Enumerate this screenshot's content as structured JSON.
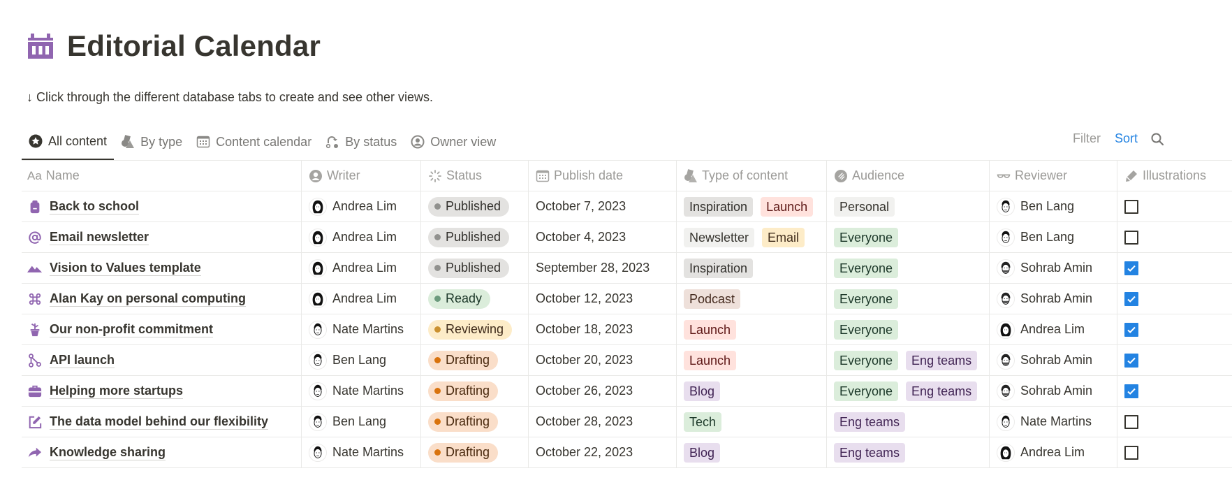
{
  "page": {
    "title": "Editorial Calendar",
    "icon": "calendar-icon",
    "description": "↓ Click through the different database tabs to create and see other views.",
    "accent": "#9065b0"
  },
  "tabs": [
    {
      "label": "All content",
      "icon": "star-circle-icon",
      "active": true
    },
    {
      "label": "By type",
      "icon": "shapes-icon",
      "active": false
    },
    {
      "label": "Content calendar",
      "icon": "calendar-icon",
      "active": false
    },
    {
      "label": "By status",
      "icon": "swap-arrows-icon",
      "active": false
    },
    {
      "label": "Owner view",
      "icon": "user-circle-icon",
      "active": false
    }
  ],
  "toolbar": {
    "filter_label": "Filter",
    "sort_label": "Sort",
    "sort_color": "#2383e2",
    "search_icon": "search-icon"
  },
  "columns": [
    {
      "label": "Name",
      "icon": "text-aa-icon"
    },
    {
      "label": "Writer",
      "icon": "person-icon"
    },
    {
      "label": "Status",
      "icon": "status-spinner-icon"
    },
    {
      "label": "Publish date",
      "icon": "calendar-icon"
    },
    {
      "label": "Type of content",
      "icon": "shapes-icon"
    },
    {
      "label": "Audience",
      "icon": "audience-icon"
    },
    {
      "label": "Reviewer",
      "icon": "glasses-icon"
    },
    {
      "label": "Illustrations",
      "icon": "pencil-icon"
    }
  ],
  "status_styles": {
    "Published": {
      "bg": "#e3e2e0",
      "dot": "#91918e",
      "fg": "#32302c"
    },
    "Ready": {
      "bg": "#dbeddb",
      "dot": "#6c9b7d",
      "fg": "#1c3829"
    },
    "Reviewing": {
      "bg": "#fdecc8",
      "dot": "#cb912f",
      "fg": "#402c1b"
    },
    "Drafting": {
      "bg": "#fadec9",
      "dot": "#d9730d",
      "fg": "#49290e"
    }
  },
  "tag_styles": {
    "Inspiration": {
      "bg": "#e3e2e0",
      "fg": "#32302c"
    },
    "Launch": {
      "bg": "#ffe2dd",
      "fg": "#5d1715"
    },
    "Newsletter": {
      "bg": "#f1f1ef",
      "fg": "#37352f"
    },
    "Email": {
      "bg": "#fdecc8",
      "fg": "#402c1b"
    },
    "Podcast": {
      "bg": "#eee0da",
      "fg": "#442a1e"
    },
    "Blog": {
      "bg": "#e8deee",
      "fg": "#412454"
    },
    "Tech": {
      "bg": "#dbeddb",
      "fg": "#1c3829"
    },
    "Personal": {
      "bg": "#f1f1ef",
      "fg": "#37352f"
    },
    "Everyone": {
      "bg": "#dbeddb",
      "fg": "#1c3829"
    },
    "Eng teams": {
      "bg": "#e8deee",
      "fg": "#412454"
    }
  },
  "rows": [
    {
      "name": "Back to school",
      "icon": "backpack-icon",
      "writer": "Andrea Lim",
      "status": "Published",
      "date": "October 7, 2023",
      "types": [
        "Inspiration",
        "Launch"
      ],
      "audience": [
        "Personal"
      ],
      "reviewer": "Ben Lang",
      "illustrations": false
    },
    {
      "name": "Email newsletter",
      "icon": "at-sign-icon",
      "writer": "Andrea Lim",
      "status": "Published",
      "date": "October 4, 2023",
      "types": [
        "Newsletter",
        "Email"
      ],
      "audience": [
        "Everyone"
      ],
      "reviewer": "Ben Lang",
      "illustrations": false
    },
    {
      "name": "Vision to Values template",
      "icon": "mountains-icon",
      "writer": "Andrea Lim",
      "status": "Published",
      "date": "September 28, 2023",
      "types": [
        "Inspiration"
      ],
      "audience": [
        "Everyone"
      ],
      "reviewer": "Sohrab Amin",
      "illustrations": true
    },
    {
      "name": "Alan Kay on personal computing",
      "icon": "command-icon",
      "writer": "Andrea Lim",
      "status": "Ready",
      "date": "October 12, 2023",
      "types": [
        "Podcast"
      ],
      "audience": [
        "Everyone"
      ],
      "reviewer": "Sohrab Amin",
      "illustrations": true
    },
    {
      "name": "Our non-profit commitment",
      "icon": "plant-pot-icon",
      "writer": "Nate Martins",
      "status": "Reviewing",
      "date": "October 18, 2023",
      "types": [
        "Launch"
      ],
      "audience": [
        "Everyone"
      ],
      "reviewer": "Andrea Lim",
      "illustrations": true
    },
    {
      "name": "API launch",
      "icon": "branch-icon",
      "writer": "Ben Lang",
      "status": "Drafting",
      "date": "October 20, 2023",
      "types": [
        "Launch"
      ],
      "audience": [
        "Everyone",
        "Eng teams"
      ],
      "reviewer": "Sohrab Amin",
      "illustrations": true
    },
    {
      "name": "Helping more startups",
      "icon": "briefcase-icon",
      "writer": "Nate Martins",
      "status": "Drafting",
      "date": "October 26, 2023",
      "types": [
        "Blog"
      ],
      "audience": [
        "Everyone",
        "Eng teams"
      ],
      "reviewer": "Sohrab Amin",
      "illustrations": true
    },
    {
      "name": "The data model behind our flexibility",
      "icon": "edit-icon",
      "writer": "Ben Lang",
      "status": "Drafting",
      "date": "October 28, 2023",
      "types": [
        "Tech"
      ],
      "audience": [
        "Eng teams"
      ],
      "reviewer": "Nate Martins",
      "illustrations": false
    },
    {
      "name": "Knowledge sharing",
      "icon": "share-arrow-icon",
      "writer": "Nate Martins",
      "status": "Drafting",
      "date": "October 22, 2023",
      "types": [
        "Blog"
      ],
      "audience": [
        "Eng teams"
      ],
      "reviewer": "Andrea Lim",
      "illustrations": false
    }
  ]
}
